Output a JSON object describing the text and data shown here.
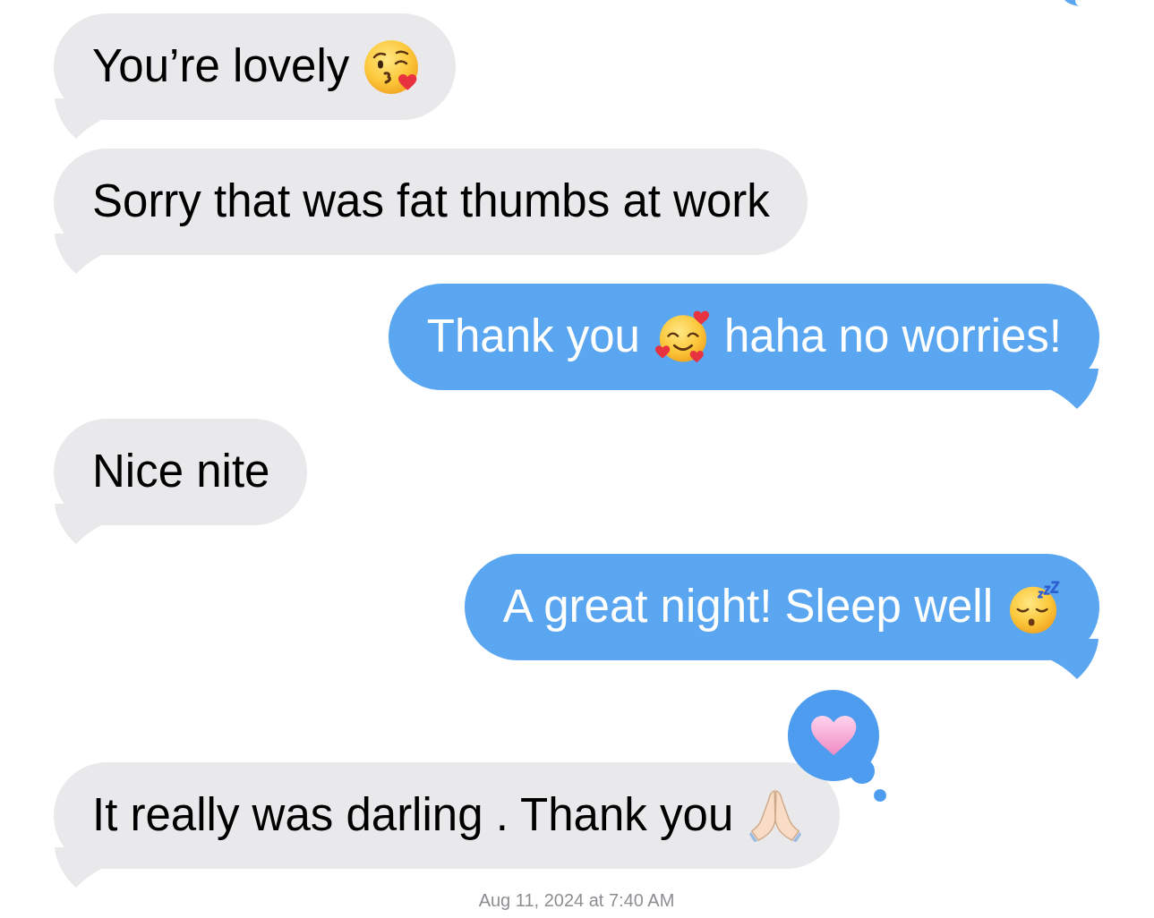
{
  "partial_message": {
    "outgoing": true
  },
  "messages": [
    {
      "outgoing": false,
      "loved": false,
      "parts": [
        {
          "kind": "text",
          "text": "You’re lovely"
        },
        {
          "kind": "kiss"
        }
      ]
    },
    {
      "outgoing": false,
      "loved": false,
      "parts": [
        {
          "kind": "text",
          "text": "Sorry that was fat thumbs at work"
        }
      ]
    },
    {
      "outgoing": true,
      "loved": false,
      "parts": [
        {
          "kind": "text",
          "text": "Thank you"
        },
        {
          "kind": "hearts"
        },
        {
          "kind": "text",
          "text": "haha no worries!"
        }
      ]
    },
    {
      "outgoing": false,
      "loved": false,
      "parts": [
        {
          "kind": "text",
          "text": "Nice nite"
        }
      ]
    },
    {
      "outgoing": true,
      "loved": false,
      "parts": [
        {
          "kind": "text",
          "text": "A great night! Sleep well"
        },
        {
          "kind": "sleepy"
        }
      ]
    },
    {
      "outgoing": false,
      "loved": true,
      "parts": [
        {
          "kind": "text",
          "text": "It really was darling . Thank you"
        },
        {
          "kind": "pray"
        }
      ]
    }
  ],
  "timestamp": "Aug 11, 2024 at 7:40 AM"
}
